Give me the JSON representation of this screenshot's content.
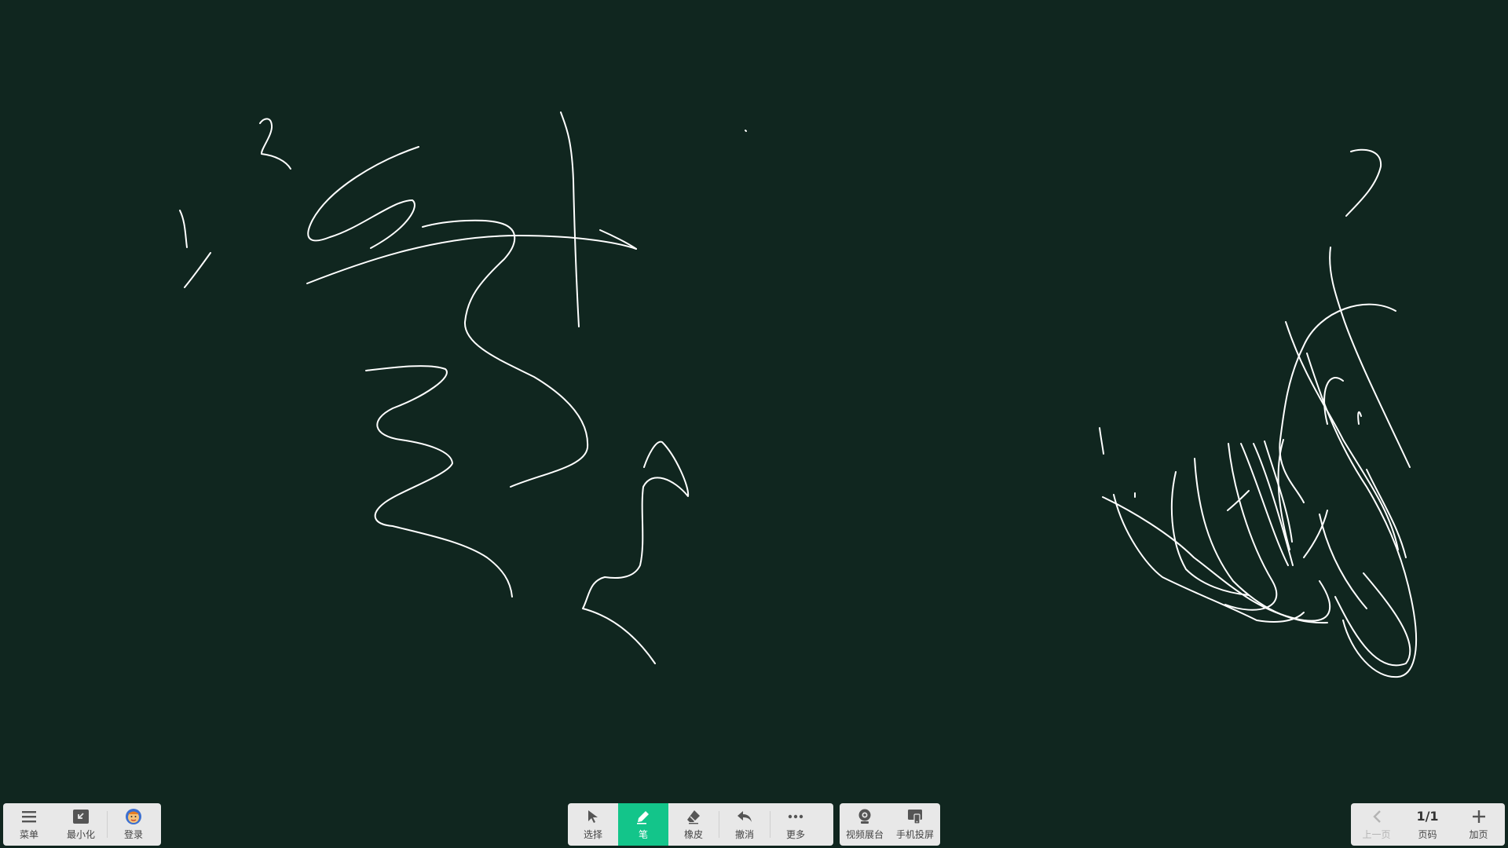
{
  "toolbar_left": {
    "menu": "菜单",
    "minimize": "最小化",
    "login": "登录"
  },
  "toolbar_center": {
    "select": "选择",
    "pen": "笔",
    "eraser": "橡皮",
    "undo": "撤消",
    "more": "更多",
    "active_tool": "pen"
  },
  "toolbar_media": {
    "video_booth": "视频展台",
    "phone_cast": "手机投屏"
  },
  "toolbar_page": {
    "prev": "上一页",
    "page_indicator": "1/1",
    "page_label": "页码",
    "add_page": "加页"
  },
  "colors": {
    "board_background": "#10261f",
    "ink": "#ffffff",
    "active_tool": "#13c58a",
    "toolbar": "#e8e8e8"
  }
}
